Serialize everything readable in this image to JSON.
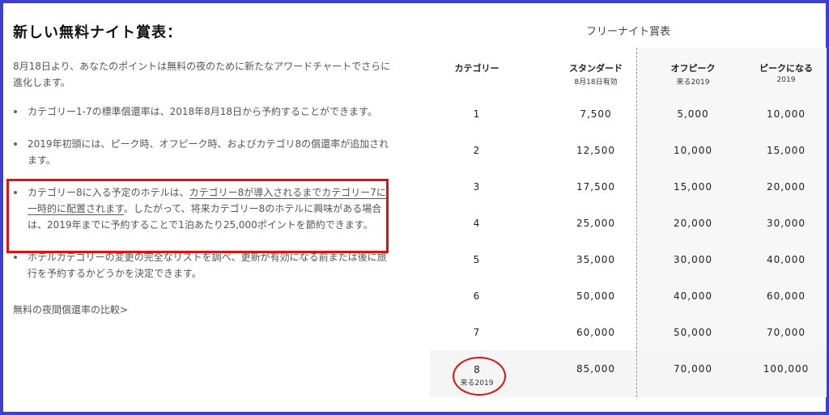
{
  "left": {
    "title": "新しい無料ナイト賞表：",
    "intro": "8月18日より、あなたのポイントは無料の夜のために新たなアワードチャートでさらに進化します。",
    "bullets": [
      "カテゴリー1-7の標準償還率は、2018年8月18日から予約することができます。",
      "2019年初頭には、ピーク時、オフピーク時、およびカテゴリ8の償還率が追加されます。"
    ],
    "bullet3": {
      "prefix": "カテゴリー8に入る予定のホテルは、",
      "underlined": "カテゴリー8が導入されるまでカテゴリー7に一時的に配置されます",
      "suffix": "。したがって、将来カテゴリー8のホテルに興味がある場合は、2019年までに予約することで1泊あたり25,000ポイントを節約できます。"
    },
    "bullet4": "ホテルカテゴリーの変更の完全なリストを調べ、更新が有効になる前または後に旅行を予約するかどうかを決定できます。",
    "compare_link": "無料の夜間償還率の比較>"
  },
  "table": {
    "title": "フリーナイト賞表",
    "headers": [
      {
        "main": "カテゴリー",
        "sub": ""
      },
      {
        "main": "スタンダード",
        "sub": "8月18日有効"
      },
      {
        "main": "オフピーク",
        "sub": "来る2019"
      },
      {
        "main": "ピークになる",
        "sub": "2019"
      }
    ],
    "rows": [
      [
        "1",
        "7,500",
        "5,000",
        "10,000"
      ],
      [
        "2",
        "12,500",
        "10,000",
        "15,000"
      ],
      [
        "3",
        "17,500",
        "15,000",
        "20,000"
      ],
      [
        "4",
        "25,000",
        "20,000",
        "30,000"
      ],
      [
        "5",
        "35,000",
        "30,000",
        "40,000"
      ],
      [
        "6",
        "50,000",
        "40,000",
        "60,000"
      ],
      [
        "7",
        "60,000",
        "50,000",
        "70,000"
      ]
    ],
    "row8": {
      "category": "8",
      "category_sub": "来る2019",
      "standard": "85,000",
      "offpeak": "70,000",
      "peak": "100,000"
    }
  },
  "colors": {
    "frame": "#3b3fd0",
    "annotation": "#e01010"
  }
}
